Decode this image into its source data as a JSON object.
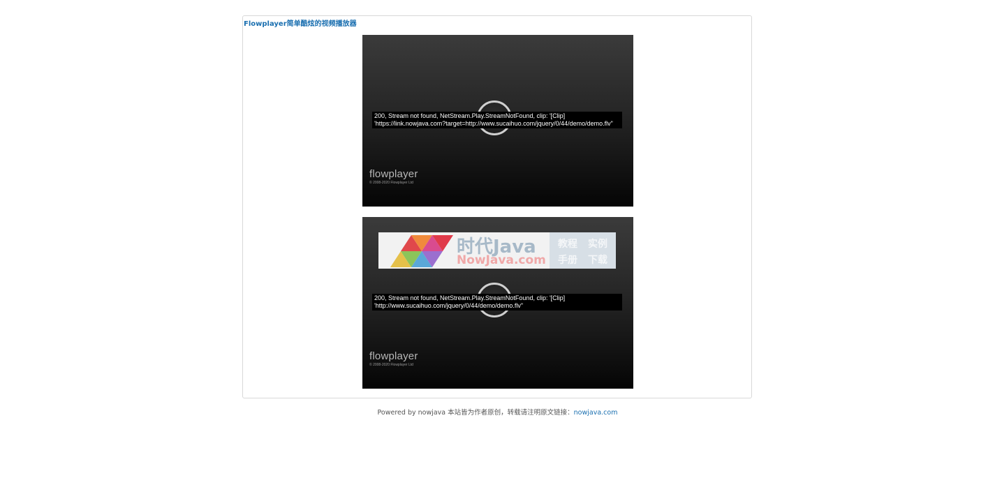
{
  "page": {
    "title": "Flowplayer简单酷炫的视频播放器"
  },
  "players": [
    {
      "error_line1": "200, Stream not found, NetStream.Play.StreamNotFound, clip: '[Clip]",
      "error_line2": "'https://link.nowjava.com?target=http://www.sucaihuo.com/jquery/0/44/demo/demo.flv\"",
      "brand": "flowplayer",
      "copyright": "© 2008-2020 Flowplayer Ltd"
    },
    {
      "error_line1": "200, Stream not found, NetStream.Play.StreamNotFound, clip: '[Clip]",
      "error_line2": "'http://www.sucaihuo.com/jquery/0/44/demo/demo.flv\"",
      "brand": "flowplayer",
      "copyright": "© 2008-2020 Flowplayer Ltd"
    }
  ],
  "watermark": {
    "title": "时代Java",
    "subtitle": "NowJava.com",
    "menu": [
      "教程",
      "实例",
      "手册",
      "下载"
    ]
  },
  "footer": {
    "text": "Powered by nowjava 本站皆为作者原创，转载请注明原文链接：",
    "link_text": "nowjava.com"
  },
  "colors": {
    "link": "#1a6fb0",
    "player_bg": "#262626",
    "error_bg": "#000000"
  }
}
